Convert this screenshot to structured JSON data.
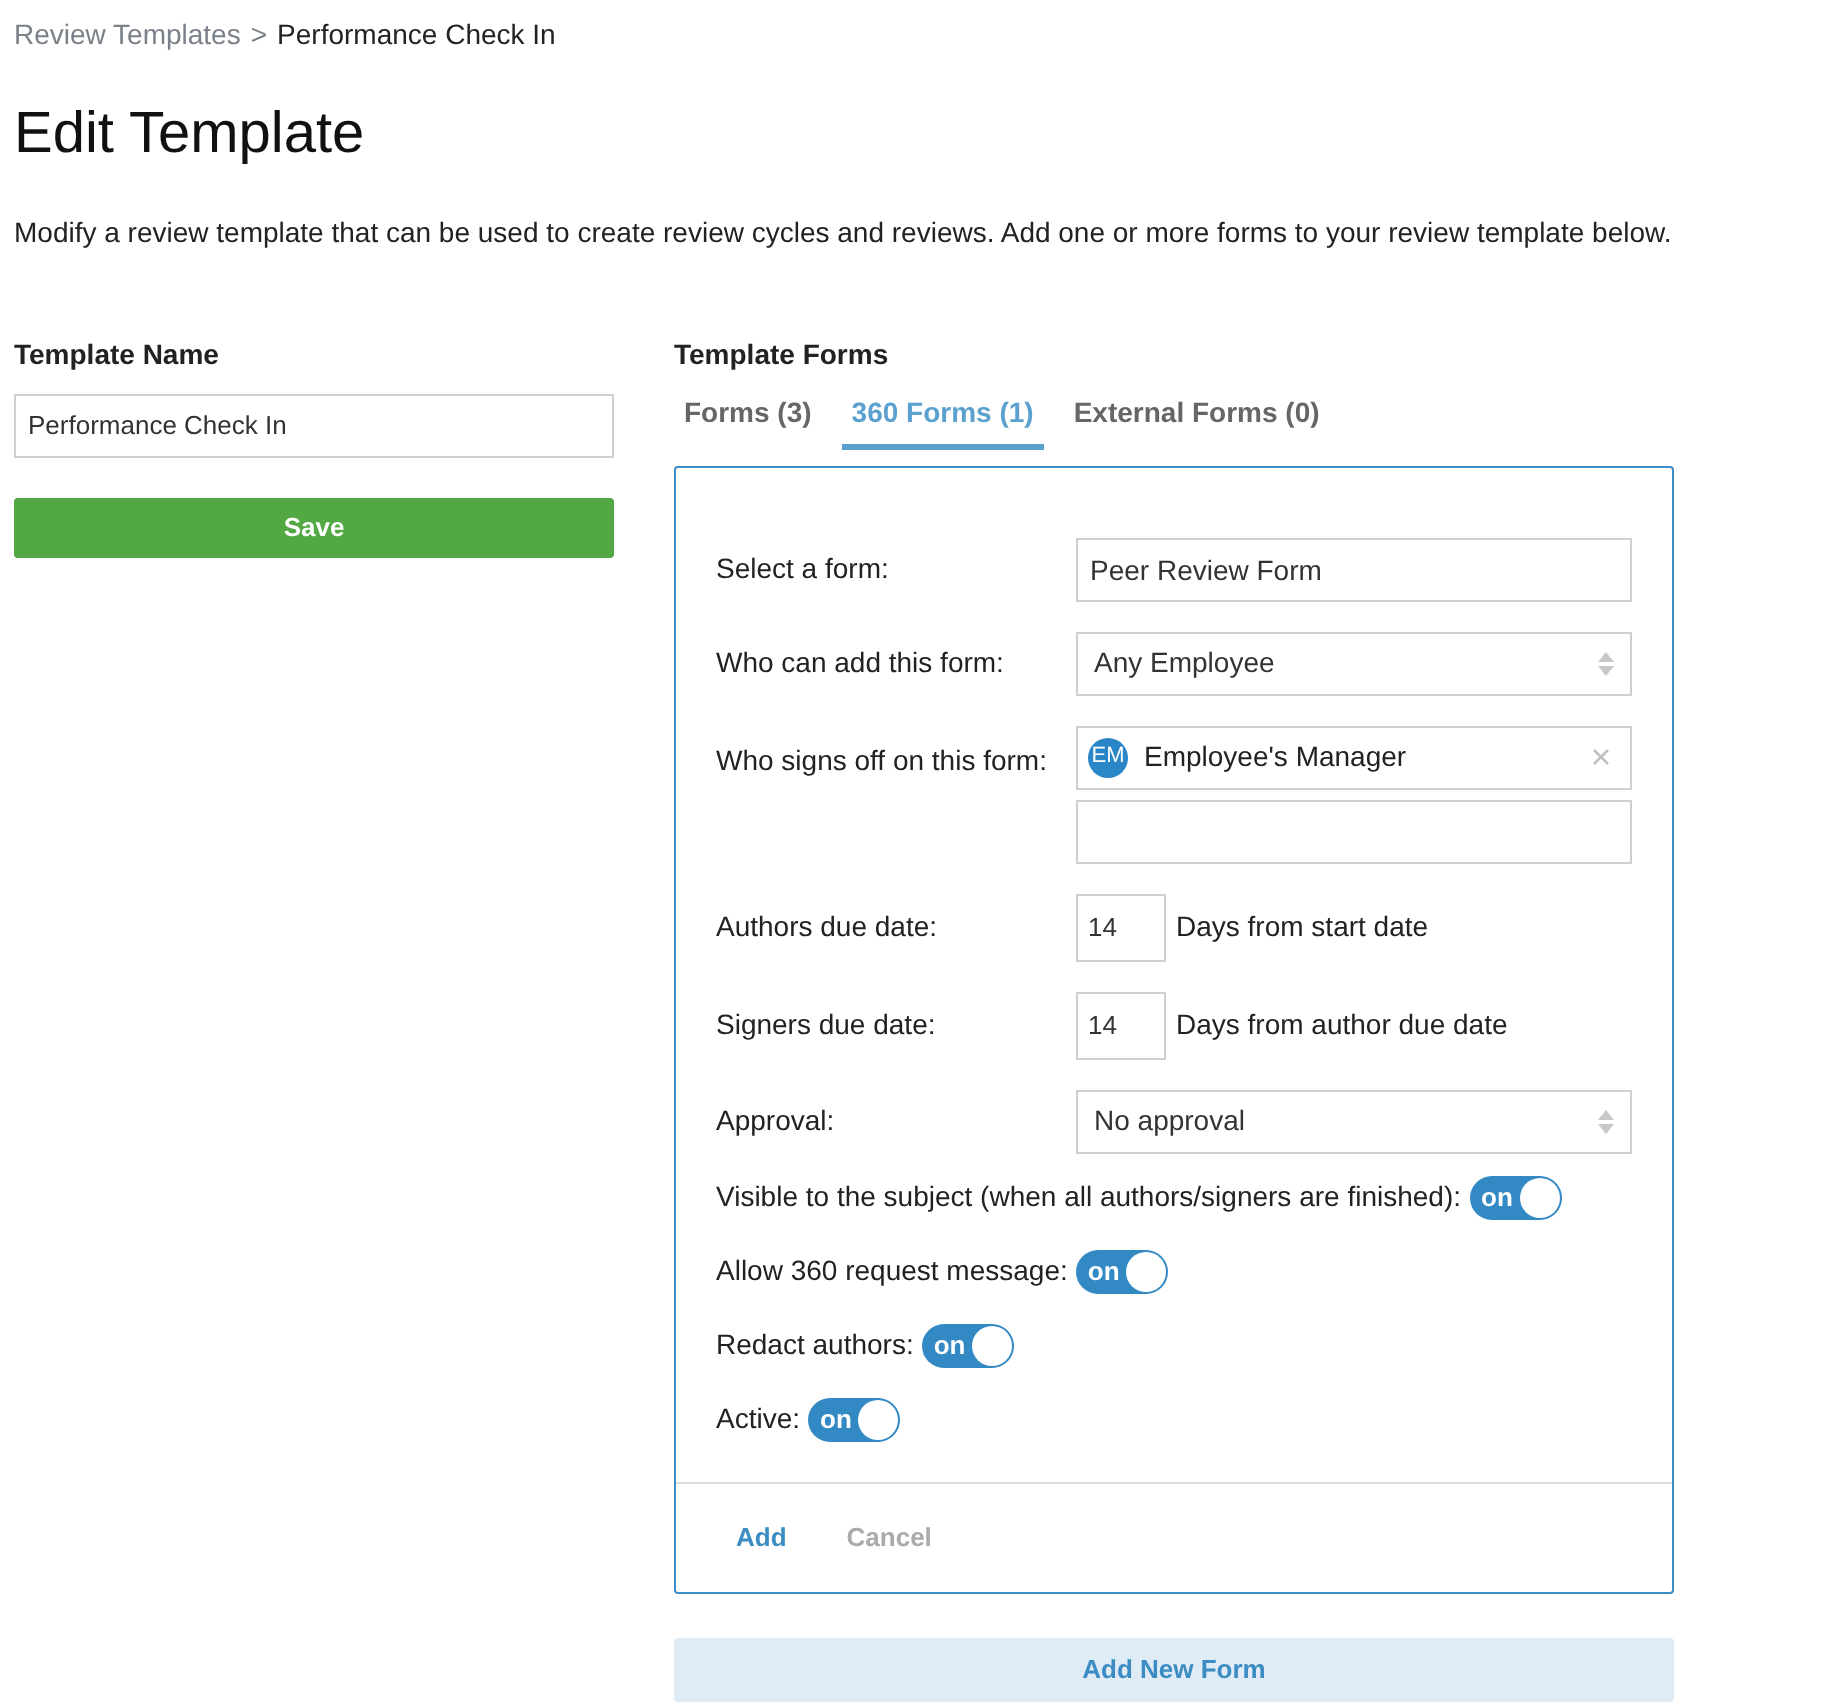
{
  "breadcrumb": {
    "parent": "Review Templates",
    "separator": ">",
    "current": "Performance Check In"
  },
  "title": "Edit Template",
  "description": "Modify a review template that can be used to create review cycles and reviews. Add one or more forms to your review template below.",
  "template_name": {
    "label": "Template Name",
    "value": "Performance Check In",
    "save_button": "Save"
  },
  "template_forms": {
    "label": "Template Forms",
    "tabs": [
      {
        "label": "Forms (3)",
        "selected": false
      },
      {
        "label": "360 Forms (1)",
        "selected": true
      },
      {
        "label": "External Forms (0)",
        "selected": false
      }
    ],
    "fields": [
      {
        "kind": "text",
        "label": "Select a form:",
        "value": "Peer Review Form"
      },
      {
        "kind": "select",
        "label": "Who can add this form:",
        "value": "Any Employee"
      },
      {
        "kind": "signers",
        "label": "Who signs off on this form:",
        "tokens": [
          {
            "initials": "EM",
            "name": "Employee's Manager"
          }
        ]
      },
      {
        "kind": "days",
        "label": "Authors due date:",
        "value": "14",
        "suffix": "Days from start date"
      },
      {
        "kind": "days",
        "label": "Signers due date:",
        "value": "14",
        "suffix": "Days from author due date"
      },
      {
        "kind": "select",
        "label": "Approval:",
        "value": "No approval"
      }
    ],
    "toggles": [
      {
        "label": "Visible to the subject (when all authors/signers are finished):",
        "on": true,
        "text": "on"
      },
      {
        "label": "Allow 360 request message:",
        "on": true,
        "text": "on"
      },
      {
        "label": "Redact authors:",
        "on": true,
        "text": "on"
      },
      {
        "label": "Active:",
        "on": true,
        "text": "on"
      }
    ],
    "actions": {
      "add": "Add",
      "cancel": "Cancel"
    },
    "add_new_form": "Add New Form"
  }
}
